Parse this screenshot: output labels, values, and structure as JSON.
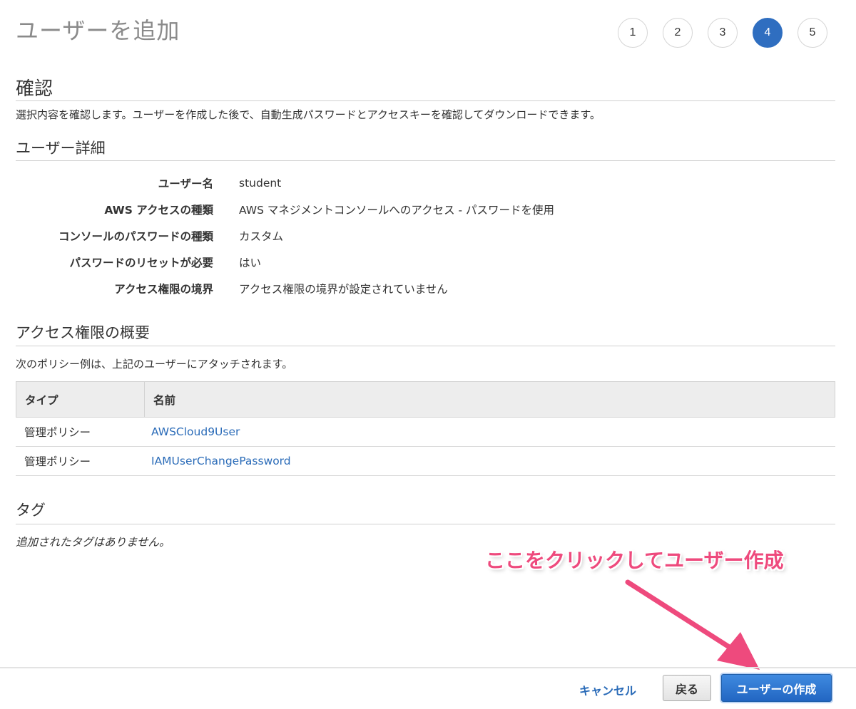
{
  "header": {
    "title": "ユーザーを追加",
    "steps": [
      "1",
      "2",
      "3",
      "4",
      "5"
    ],
    "active_step": "4"
  },
  "review": {
    "heading": "確認",
    "description": "選択内容を確認します。ユーザーを作成した後で、自動生成パスワードとアクセスキーを確認してダウンロードできます。"
  },
  "user_details": {
    "heading": "ユーザー詳細",
    "rows": [
      {
        "label": "ユーザー名",
        "value": "student"
      },
      {
        "label": "AWS アクセスの種類",
        "value": "AWS マネジメントコンソールへのアクセス - パスワードを使用"
      },
      {
        "label": "コンソールのパスワードの種類",
        "value": "カスタム"
      },
      {
        "label": "パスワードのリセットが必要",
        "value": "はい"
      },
      {
        "label": "アクセス権限の境界",
        "value": "アクセス権限の境界が設定されていません"
      }
    ]
  },
  "permissions": {
    "heading": "アクセス権限の概要",
    "description": "次のポリシー例は、上記のユーザーにアタッチされます。",
    "columns": [
      "タイプ",
      "名前"
    ],
    "rows": [
      {
        "type": "管理ポリシー",
        "name": "AWSCloud9User"
      },
      {
        "type": "管理ポリシー",
        "name": "IAMUserChangePassword"
      }
    ]
  },
  "tags": {
    "heading": "タグ",
    "empty_text": "追加されたタグはありません。"
  },
  "annotation": {
    "text": "ここをクリックしてユーザー作成",
    "color": "#ee4a7d"
  },
  "footer": {
    "cancel_label": "キャンセル",
    "back_label": "戻る",
    "create_label": "ユーザーの作成"
  },
  "colors": {
    "primary": "#2f6ec0",
    "link": "#2a6bb8"
  }
}
